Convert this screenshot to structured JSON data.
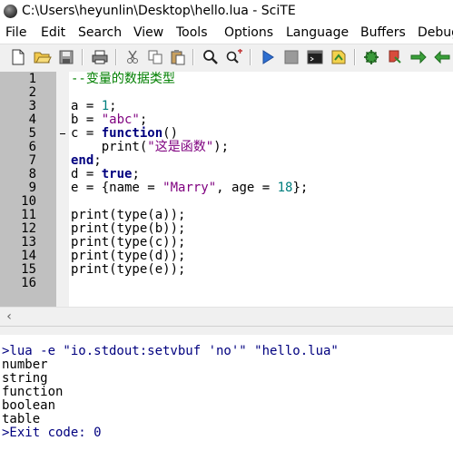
{
  "window": {
    "title": "C:\\Users\\heyunlin\\Desktop\\hello.lua - SciTE"
  },
  "menu": [
    "File",
    "Edit",
    "Search",
    "View",
    "Tools",
    "Options",
    "Language",
    "Buffers",
    "Debug"
  ],
  "toolbar": {
    "buttons": [
      "new-file",
      "open-file",
      "save-file",
      "print",
      "cut",
      "copy",
      "paste",
      "find",
      "replace",
      "go",
      "stop",
      "terminal",
      "compile",
      "build",
      "jump",
      "next",
      "previous"
    ]
  },
  "editor": {
    "line_numbers": [
      "1",
      "2",
      "3",
      "4",
      "5",
      "6",
      "7",
      "8",
      "9",
      "10",
      "11",
      "12",
      "13",
      "14",
      "15",
      "16"
    ],
    "lines": {
      "l1": {
        "comment": "--变量的数据类型"
      },
      "l3": {
        "a": "a = ",
        "n": "1",
        "s": ";"
      },
      "l4": {
        "a": "b = ",
        "str": "\"abc\"",
        "s": ";"
      },
      "l5": {
        "a": "c = ",
        "kw": "function",
        "b": "()"
      },
      "l6": {
        "a": "    print(",
        "str": "\"这是函数\"",
        "b": ");"
      },
      "l7": {
        "kw": "end",
        "s": ";"
      },
      "l8": {
        "a": "d = ",
        "kw": "true",
        "s": ";"
      },
      "l9": {
        "a": "e = {name = ",
        "str": "\"Marry\"",
        "b": ", age = ",
        "n": "18",
        "c": "};"
      },
      "l11": "print(type(a));",
      "l12": "print(type(b));",
      "l13": "print(type(c));",
      "l14": "print(type(d));",
      "l15": "print(type(e));"
    }
  },
  "output": {
    "command": ">lua -e \"io.stdout:setvbuf 'no'\" \"hello.lua\"",
    "results": [
      "number",
      "string",
      "function",
      "boolean",
      "table"
    ],
    "exit": ">Exit code: 0"
  },
  "colors": {
    "comment": "#007f00",
    "number": "#007f7f",
    "string": "#7f007f",
    "keyword": "#00007f",
    "gutter": "#c0c0c0"
  }
}
